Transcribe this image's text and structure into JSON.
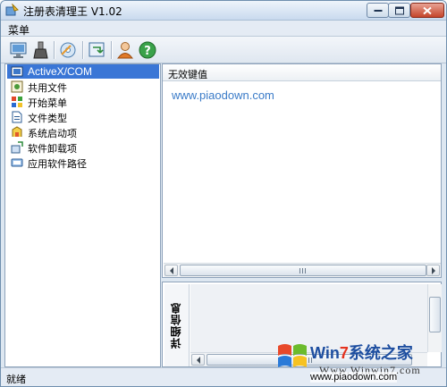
{
  "window": {
    "title": "注册表清理王 V1.02",
    "app_icon": "registry-cleaner-icon",
    "minimize_icon": "minimize-icon",
    "maximize_icon": "maximize-icon",
    "close_icon": "close-icon"
  },
  "menu": {
    "items": [
      {
        "label": "菜单"
      }
    ]
  },
  "toolbar": {
    "buttons": [
      {
        "icon": "scan-computer-icon"
      },
      {
        "icon": "brush-clean-icon"
      },
      {
        "icon": "backup-disk-icon"
      },
      {
        "icon": "restore-icon"
      },
      {
        "icon": "user-icon"
      },
      {
        "icon": "help-icon"
      }
    ]
  },
  "tree": {
    "items": [
      {
        "label": "ActiveX/COM",
        "icon": "activex-icon",
        "selected": true
      },
      {
        "label": "共用文件",
        "icon": "shared-files-icon"
      },
      {
        "label": "开始菜单",
        "icon": "start-menu-icon"
      },
      {
        "label": "文件类型",
        "icon": "file-type-icon"
      },
      {
        "label": "系统启动项",
        "icon": "startup-icon"
      },
      {
        "label": "软件卸载项",
        "icon": "uninstall-icon"
      },
      {
        "label": "应用软件路径",
        "icon": "app-path-icon"
      }
    ]
  },
  "results": {
    "column_header": "无效键值",
    "rows": [
      "www.piaodown.com"
    ]
  },
  "detail": {
    "tab_label": "详细信息"
  },
  "status": {
    "text": "就绪"
  },
  "watermark": {
    "brand_prefix": "Win",
    "brand_num": "7",
    "brand_suffix": "系统之家",
    "sub": "Www.Winwin7.com",
    "url": "www.piaodown.com"
  },
  "colors": {
    "selection": "#3a76d6",
    "link_text": "#3a7bc8"
  }
}
